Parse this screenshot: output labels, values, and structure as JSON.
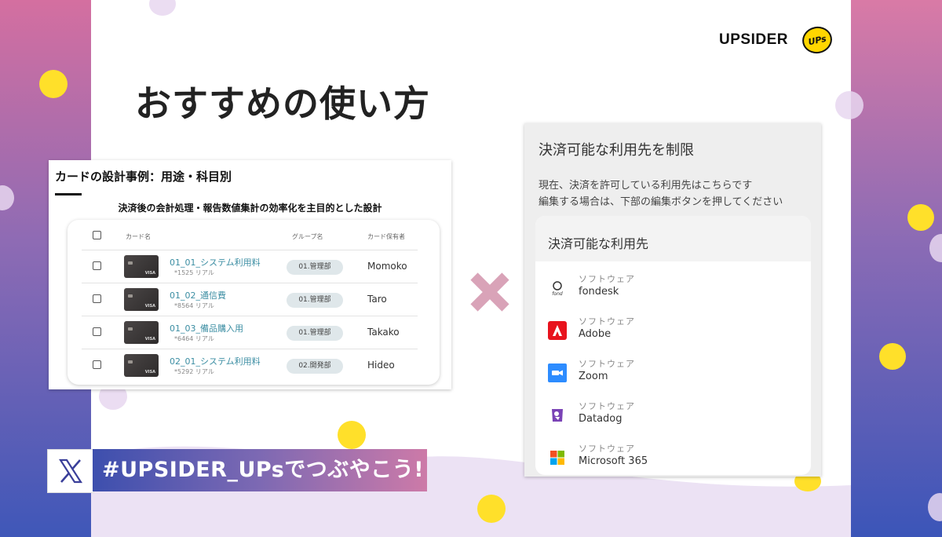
{
  "brand": {
    "wordmark": "UPSIDER",
    "logo_text": "UPs"
  },
  "slide": {
    "title": "おすすめの使い方"
  },
  "left_card": {
    "title": "カードの設計事例：用途・科目別",
    "subtitle": "決済後の会計処理・報告数値集計の効率化を主目的とした設計",
    "columns": [
      "カード名",
      "グループ名",
      "カード保有者"
    ],
    "rows": [
      {
        "name": "01_01_システム利用料",
        "number": "*1525 リアル",
        "group": "01.管理部",
        "holder": "Momoko"
      },
      {
        "name": "01_02_通信費",
        "number": "*8564 リアル",
        "group": "01.管理部",
        "holder": "Taro"
      },
      {
        "name": "01_03_備品購入用",
        "number": "*6464 リアル",
        "group": "01.管理部",
        "holder": "Takako"
      },
      {
        "name": "02_01_システム利用料",
        "number": "*5292 リアル",
        "group": "02.開発部",
        "holder": "Hideo"
      }
    ],
    "card_brand": "VISA"
  },
  "right_card": {
    "title": "決済可能な利用先を制限",
    "line1": "現在、決済を許可している利用先はこちらです",
    "line2": "編集する場合は、下部の編集ボタンを押してください",
    "box_title": "決済可能な利用先",
    "services": [
      {
        "type": "ソフトウェア",
        "name": "fondesk",
        "icon": "fondesk-icon"
      },
      {
        "type": "ソフトウェア",
        "name": "Adobe",
        "icon": "adobe-icon"
      },
      {
        "type": "ソフトウェア",
        "name": "Zoom",
        "icon": "zoom-icon"
      },
      {
        "type": "ソフトウェア",
        "name": "Datadog",
        "icon": "datadog-icon"
      },
      {
        "type": "ソフトウェア",
        "name": "Microsoft 365",
        "icon": "microsoft-icon"
      }
    ]
  },
  "banner": {
    "hashtag": "#UPSIDER_UPsでつぶやこう!"
  },
  "colors": {
    "link": "#3c8ea3",
    "yellow_dot": "#ffe02a",
    "cross": "#d9a3b8"
  }
}
